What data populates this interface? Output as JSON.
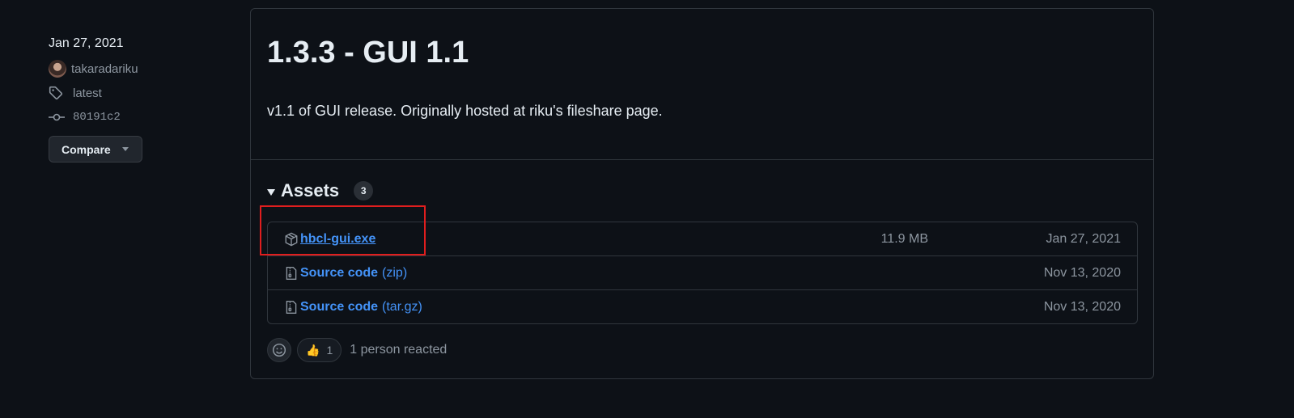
{
  "sidebar": {
    "date": "Jan 27, 2021",
    "author": "takaradariku",
    "tag": "latest",
    "commit": "80191c2",
    "compare_label": "Compare"
  },
  "release": {
    "title": "1.3.3 - GUI 1.1",
    "body": "v1.1 of GUI release. Originally hosted at riku's fileshare page."
  },
  "assets": {
    "label": "Assets",
    "count": "3",
    "items": [
      {
        "name": "hbcl-gui.exe",
        "ext": "",
        "size": "11.9 MB",
        "date": "Jan 27, 2021",
        "icon": "package-icon"
      },
      {
        "name": "Source code",
        "ext": "(zip)",
        "size": "",
        "date": "Nov 13, 2020",
        "icon": "file-zip-icon"
      },
      {
        "name": "Source code",
        "ext": "(tar.gz)",
        "size": "",
        "date": "Nov 13, 2020",
        "icon": "file-zip-icon"
      }
    ]
  },
  "reactions": {
    "thumbs_count": "1",
    "summary": "1 person reacted"
  },
  "colors": {
    "background": "#0d1117",
    "link": "#4493f8",
    "highlight": "#e01e1e"
  }
}
